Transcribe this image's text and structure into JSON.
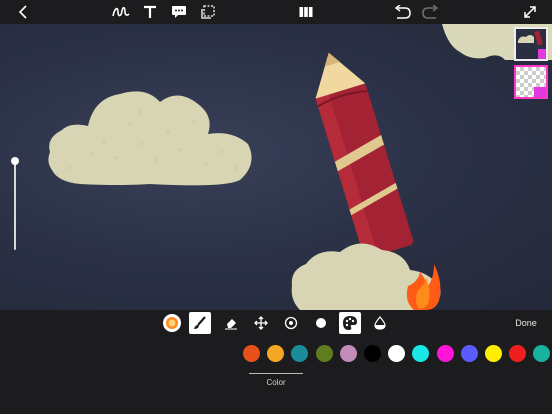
{
  "toolbar": {
    "left": [
      {
        "name": "back-chevron-icon"
      },
      {
        "name": "draw-squiggle-icon"
      },
      {
        "name": "text-icon"
      },
      {
        "name": "sticker-speech-icon"
      },
      {
        "name": "selection-icon"
      }
    ],
    "center": {
      "name": "panels-icon"
    },
    "right": [
      {
        "name": "undo-icon"
      },
      {
        "name": "redo-icon"
      },
      {
        "name": "fullscreen-expand-icon"
      }
    ]
  },
  "tools": [
    {
      "name": "brush-preview",
      "active": false
    },
    {
      "name": "brush-icon",
      "active": true
    },
    {
      "name": "eraser-icon",
      "active": false
    },
    {
      "name": "move-icon",
      "active": false
    },
    {
      "name": "target-icon",
      "active": false
    },
    {
      "name": "dot-icon",
      "active": false
    },
    {
      "name": "palette-icon",
      "active": true
    },
    {
      "name": "opacity-drop-icon",
      "active": false
    }
  ],
  "done_label": "Done",
  "color_label": "Color",
  "colors": [
    "#e8501a",
    "#f5a623",
    "#1a8c9a",
    "#5e7d1e",
    "#c48ab9",
    "#000000",
    "#ffffff",
    "#19e6e6",
    "#ff14d8",
    "#5a5cff",
    "#ffee00",
    "#f01e1e",
    "#17b2a0"
  ]
}
